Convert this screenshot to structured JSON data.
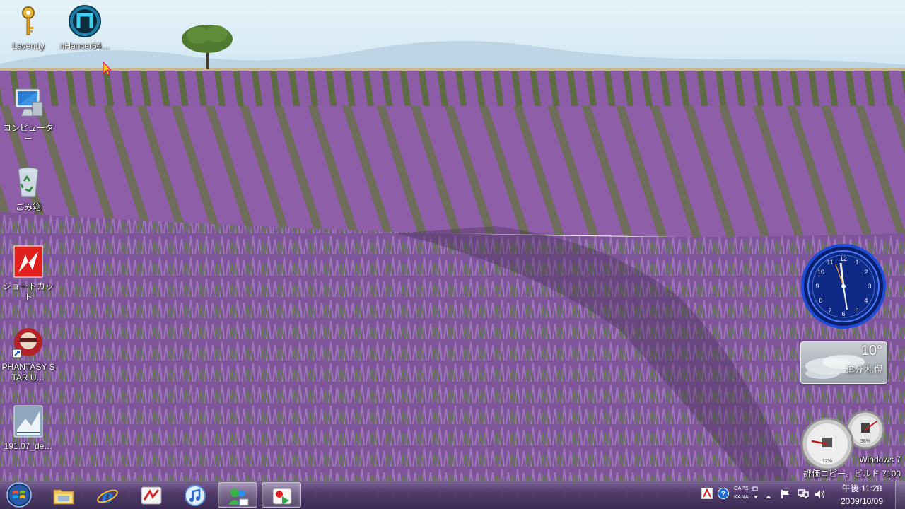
{
  "desktop": {
    "icons": [
      {
        "label": "Lavendy",
        "icon": "key-icon"
      },
      {
        "label": "nHancer64…",
        "icon": "nhancer-icon"
      },
      {
        "label": "コンピューター",
        "icon": "computer-icon"
      },
      {
        "label": "ごみ箱",
        "icon": "recycle-bin-icon"
      },
      {
        "label": "ショートカット",
        "icon": "mirrors-edge-icon"
      },
      {
        "label": "PHANTASY STAR U…",
        "icon": "phantasy-star-icon"
      },
      {
        "label": "191.07_de…",
        "icon": "nvidia-installer-icon"
      }
    ]
  },
  "gadgets": {
    "weather": {
      "temperature": "10°",
      "location": "追分 札幌"
    },
    "meter": {
      "cpu": "12%",
      "memory": "38%"
    }
  },
  "watermark": {
    "line1": "Windows 7",
    "line2": "評価コピー。ビルド 7100"
  },
  "taskbar": {
    "start": "start-orb-icon",
    "buttons": [
      {
        "icon": "explorer-folder-icon",
        "active": false
      },
      {
        "icon": "internet-explorer-icon",
        "active": false
      },
      {
        "icon": "app-red-icon",
        "active": false
      },
      {
        "icon": "itunes-icon",
        "active": false
      },
      {
        "icon": "messenger-icon",
        "active": true
      },
      {
        "icon": "media-app-icon",
        "active": true
      }
    ],
    "tray": {
      "ime_caps": "CAPS",
      "ime_kana": "KANA",
      "time": "午後 11:28",
      "date": "2009/10/09"
    }
  },
  "colors": {
    "lavender": "#8e5aa6",
    "sky": "#d6ecf6",
    "taskbar": "#4b3764"
  }
}
